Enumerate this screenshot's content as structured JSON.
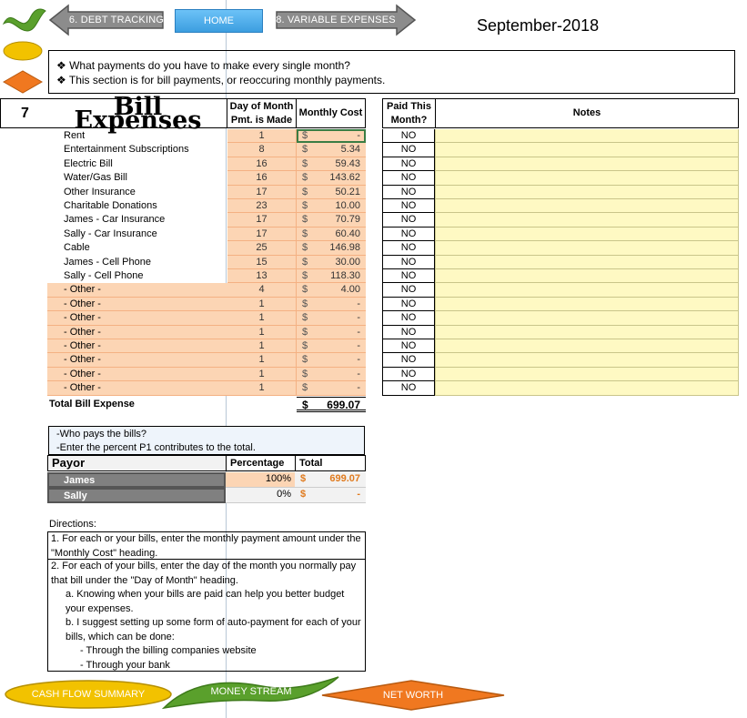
{
  "nav": {
    "prev_label": "6. DEBT TRACKING",
    "home_label": "HOME",
    "next_label": "8. VARIABLE EXPENSES"
  },
  "month": "September-2018",
  "intro": {
    "line1": "❖ What payments do you have to make every single month?",
    "line2": "❖ This section is for bill payments, or reoccuring monthly payments."
  },
  "header": {
    "number": "7",
    "title": "Bill Expenses",
    "day_col": "Day of Month Pmt. is Made",
    "cost_col": "Monthly Cost",
    "paid_col": "Paid This Month?",
    "notes_col": "Notes"
  },
  "bills": [
    {
      "name": "Rent",
      "day": "1",
      "cost": "-",
      "paid": "NO"
    },
    {
      "name": "Entertainment Subscriptions",
      "day": "8",
      "cost": "5.34",
      "paid": "NO"
    },
    {
      "name": "Electric Bill",
      "day": "16",
      "cost": "59.43",
      "paid": "NO"
    },
    {
      "name": "Water/Gas Bill",
      "day": "16",
      "cost": "143.62",
      "paid": "NO"
    },
    {
      "name": "Other Insurance",
      "day": "17",
      "cost": "50.21",
      "paid": "NO"
    },
    {
      "name": "Charitable Donations",
      "day": "23",
      "cost": "10.00",
      "paid": "NO"
    },
    {
      "name": "James - Car Insurance",
      "day": "17",
      "cost": "70.79",
      "paid": "NO"
    },
    {
      "name": "Sally - Car Insurance",
      "day": "17",
      "cost": "60.40",
      "paid": "NO"
    },
    {
      "name": "Cable",
      "day": "25",
      "cost": "146.98",
      "paid": "NO"
    },
    {
      "name": "James - Cell Phone",
      "day": "15",
      "cost": "30.00",
      "paid": "NO"
    },
    {
      "name": "Sally - Cell Phone",
      "day": "13",
      "cost": "118.30",
      "paid": "NO"
    },
    {
      "name": "- Other -",
      "day": "4",
      "cost": "4.00",
      "paid": "NO"
    },
    {
      "name": "- Other -",
      "day": "1",
      "cost": "-",
      "paid": "NO"
    },
    {
      "name": "- Other -",
      "day": "1",
      "cost": "-",
      "paid": "NO"
    },
    {
      "name": "- Other -",
      "day": "1",
      "cost": "-",
      "paid": "NO"
    },
    {
      "name": "- Other -",
      "day": "1",
      "cost": "-",
      "paid": "NO"
    },
    {
      "name": "- Other -",
      "day": "1",
      "cost": "-",
      "paid": "NO"
    },
    {
      "name": "- Other -",
      "day": "1",
      "cost": "-",
      "paid": "NO"
    },
    {
      "name": "- Other -",
      "day": "1",
      "cost": "-",
      "paid": "NO"
    }
  ],
  "currency_symbol": "$",
  "total": {
    "label": "Total Bill Expense",
    "value": "699.07"
  },
  "who_pays": {
    "line1": "-Who pays the bills?",
    "line2": "-Enter the percent P1 contributes to the total."
  },
  "payor": {
    "col_payor": "Payor",
    "col_pct": "Percentage",
    "col_total": "Total",
    "rows": [
      {
        "name": "James",
        "pct": "100%",
        "total": "699.07"
      },
      {
        "name": "Sally",
        "pct": "0%",
        "total": "-"
      }
    ]
  },
  "directions": {
    "title": "Directions:",
    "step1": "1. For each or your bills, enter the monthly payment amount under the \"Monthly Cost\" heading.",
    "step2": "2. For each of your bills, enter the day of the month you normally pay that bill under the \"Day of Month\" heading.",
    "step2a": "a. Knowing when your bills are paid can help you better budget your expenses.",
    "step2b": "b. I suggest setting up some form of auto-payment for each of your bills, which can be done:",
    "step2b1": "- Through the billing companies website",
    "step2b2": "- Through your bank"
  },
  "bottom_nav": {
    "cash_flow": "CASH FLOW SUMMARY",
    "money_stream": "MONEY STREAM",
    "net_worth": "NET WORTH"
  },
  "colors": {
    "input_fill": "#fcd5b4",
    "notes_fill": "#fef9c3",
    "home_blue": "#4aa8e8",
    "green": "#5aa02c",
    "yellow": "#f2c200",
    "orange": "#f07820"
  }
}
